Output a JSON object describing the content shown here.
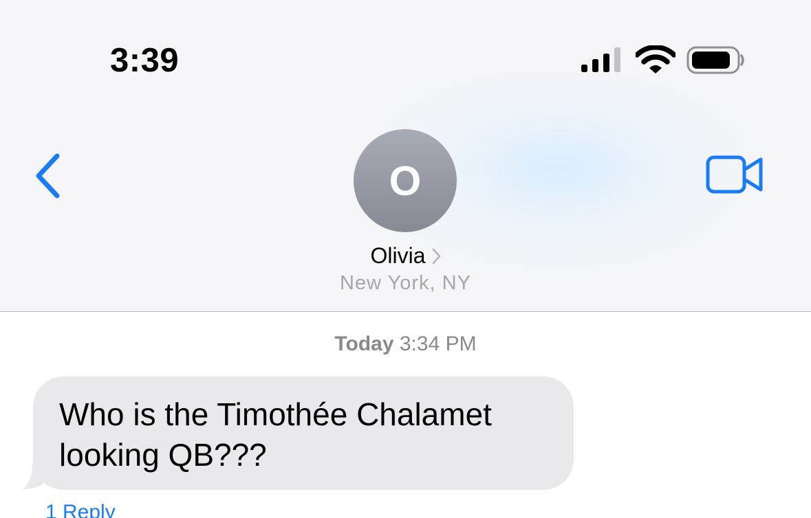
{
  "status_bar": {
    "time": "3:39",
    "signal_icon": "cellular-signal-icon",
    "wifi_icon": "wifi-icon",
    "battery_icon": "battery-icon"
  },
  "nav": {
    "back_icon": "chevron-left-icon",
    "video_icon": "video-camera-icon",
    "accent_color": "#1a7cf5"
  },
  "contact": {
    "initial": "O",
    "name": "Olivia",
    "location": "New York, NY"
  },
  "conversation": {
    "timestamp_day": "Today",
    "timestamp_time": "3:34 PM",
    "messages": [
      {
        "text": "Who is the Timothée Chalamet looking QB???",
        "direction": "incoming",
        "bubble_color": "#e9e9eb"
      }
    ],
    "reply_link": "1 Reply"
  }
}
